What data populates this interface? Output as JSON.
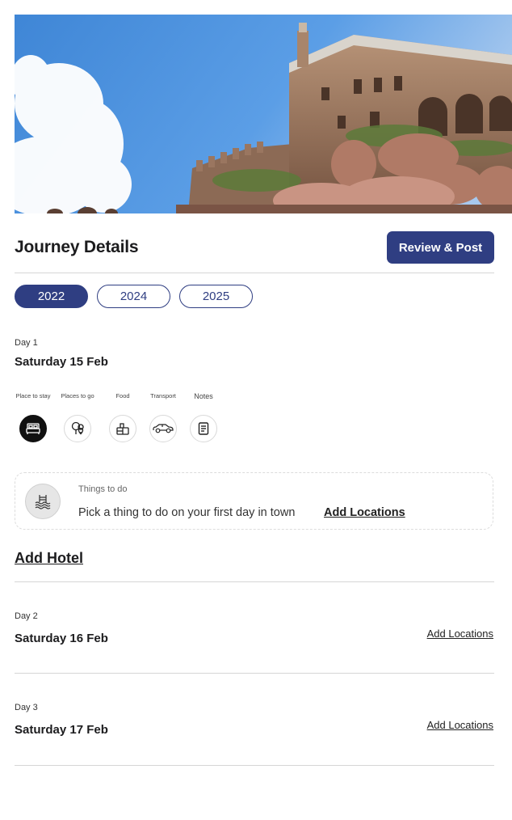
{
  "hero": {
    "image": "hilltop-fort-photo"
  },
  "header": {
    "title": "Journey Details",
    "review_button": "Review & Post"
  },
  "years": [
    {
      "label": "2022",
      "active": true
    },
    {
      "label": "2024",
      "active": false
    },
    {
      "label": "2025",
      "active": false
    }
  ],
  "days": [
    {
      "day_label": "Day 1",
      "date": "Saturday 15 Feb",
      "categories": [
        {
          "label": "Place to stay",
          "icon": "bed-icon",
          "active": true
        },
        {
          "label": "Places to go",
          "icon": "tree-location-icon",
          "active": false
        },
        {
          "label": "Food",
          "icon": "food-bag-icon",
          "active": false
        },
        {
          "label": "Transport",
          "icon": "car-icon",
          "active": false
        },
        {
          "label": "Notes",
          "icon": "notes-icon",
          "active": false
        }
      ],
      "things_to_do": {
        "title": "Things to do",
        "text": "Pick a thing to do on your first day in town",
        "link": "Add Locations",
        "icon": "water-waves-icon"
      },
      "add_hotel": "Add Hotel"
    },
    {
      "day_label": "Day 2",
      "date": "Saturday 16 Feb",
      "add_locations": "Add Locations"
    },
    {
      "day_label": "Day 3",
      "date": "Saturday 17 Feb",
      "add_locations": "Add Locations"
    }
  ],
  "colors": {
    "accent": "#2f3e82",
    "active_icon_bg": "#111111",
    "divider": "#d6d6d6"
  }
}
